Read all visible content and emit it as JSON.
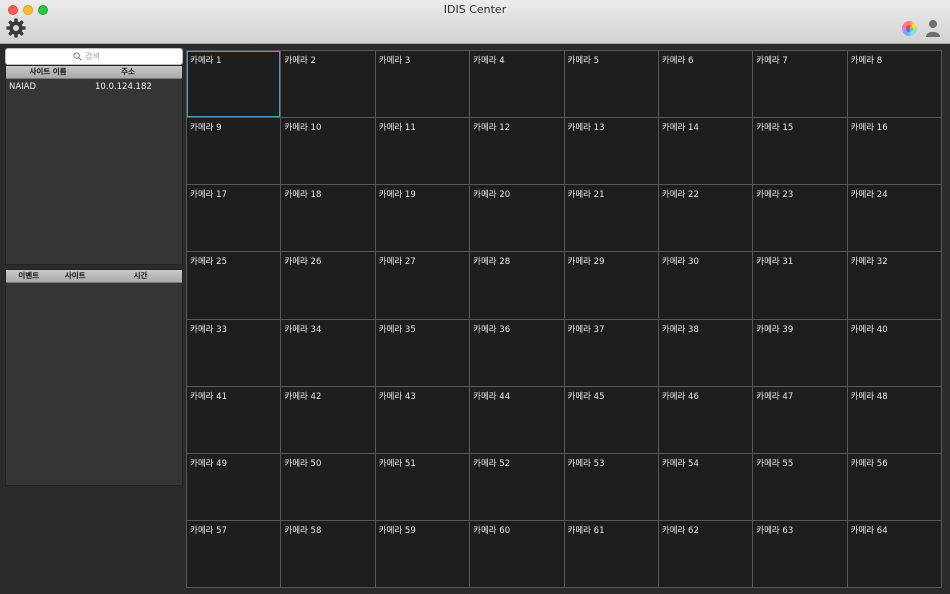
{
  "window": {
    "title": "IDIS Center"
  },
  "toolbar": {
    "settings_icon": "gear-icon",
    "color_icon": "color-wheel-icon",
    "user_icon": "user-icon"
  },
  "search": {
    "placeholder": "검색"
  },
  "sites_table": {
    "columns": [
      "사이트 이름",
      "주소"
    ],
    "rows": [
      {
        "name": "NAIAD",
        "address": "10.0.124.182"
      }
    ]
  },
  "events_table": {
    "columns": [
      "이벤트",
      "사이트",
      "시간"
    ],
    "rows": []
  },
  "camera_grid": {
    "columns": 8,
    "rows": 8,
    "selected_index": 0,
    "cameras": [
      "카메라 1",
      "카메라 2",
      "카메라 3",
      "카메라 4",
      "카메라 5",
      "카메라 6",
      "카메라 7",
      "카메라 8",
      "카메라 9",
      "카메라 10",
      "카메라 11",
      "카메라 12",
      "카메라 13",
      "카메라 14",
      "카메라 15",
      "카메라 16",
      "카메라 17",
      "카메라 18",
      "카메라 19",
      "카메라 20",
      "카메라 21",
      "카메라 22",
      "카메라 23",
      "카메라 24",
      "카메라 25",
      "카메라 26",
      "카메라 27",
      "카메라 28",
      "카메라 29",
      "카메라 30",
      "카메라 31",
      "카메라 32",
      "카메라 33",
      "카메라 34",
      "카메라 35",
      "카메라 36",
      "카메라 37",
      "카메라 38",
      "카메라 39",
      "카메라 40",
      "카메라 41",
      "카메라 42",
      "카메라 43",
      "카메라 44",
      "카메라 45",
      "카메라 46",
      "카메라 47",
      "카메라 48",
      "카메라 49",
      "카메라 50",
      "카메라 51",
      "카메라 52",
      "카메라 53",
      "카메라 54",
      "카메라 55",
      "카메라 56",
      "카메라 57",
      "카메라 58",
      "카메라 59",
      "카메라 60",
      "카메라 61",
      "카메라 62",
      "카메라 63",
      "카메라 64"
    ]
  }
}
